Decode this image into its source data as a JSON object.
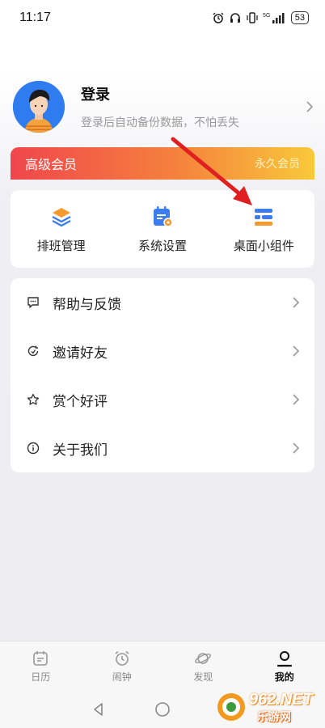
{
  "status": {
    "time": "11:17",
    "battery": "53",
    "network": "5G"
  },
  "profile": {
    "name": "登录",
    "subtitle": "登录后自动备份数据，不怕丢失"
  },
  "vip": {
    "title": "高级会员",
    "right_label": "永久会员"
  },
  "quick_actions": [
    {
      "label": "排班管理",
      "icon": "layers-icon"
    },
    {
      "label": "系统设置",
      "icon": "calendar-settings-icon"
    },
    {
      "label": "桌面小组件",
      "icon": "widget-icon"
    }
  ],
  "menu": [
    {
      "label": "帮助与反馈",
      "icon": "feedback-icon"
    },
    {
      "label": "邀请好友",
      "icon": "invite-icon"
    },
    {
      "label": "赏个好评",
      "icon": "star-icon"
    },
    {
      "label": "关于我们",
      "icon": "info-icon"
    }
  ],
  "tabs": [
    {
      "label": "日历",
      "icon": "calendar-icon"
    },
    {
      "label": "闹钟",
      "icon": "alarm-icon"
    },
    {
      "label": "发现",
      "icon": "planet-icon"
    },
    {
      "label": "我的",
      "icon": "user-icon",
      "active": true
    }
  ],
  "watermark": {
    "brand": "962.NET",
    "sub": "乐游网"
  },
  "colors": {
    "accent": "#3b7cf0",
    "vip_start": "#f0464c",
    "vip_end": "#f8c93a",
    "arrow": "#e02020"
  }
}
